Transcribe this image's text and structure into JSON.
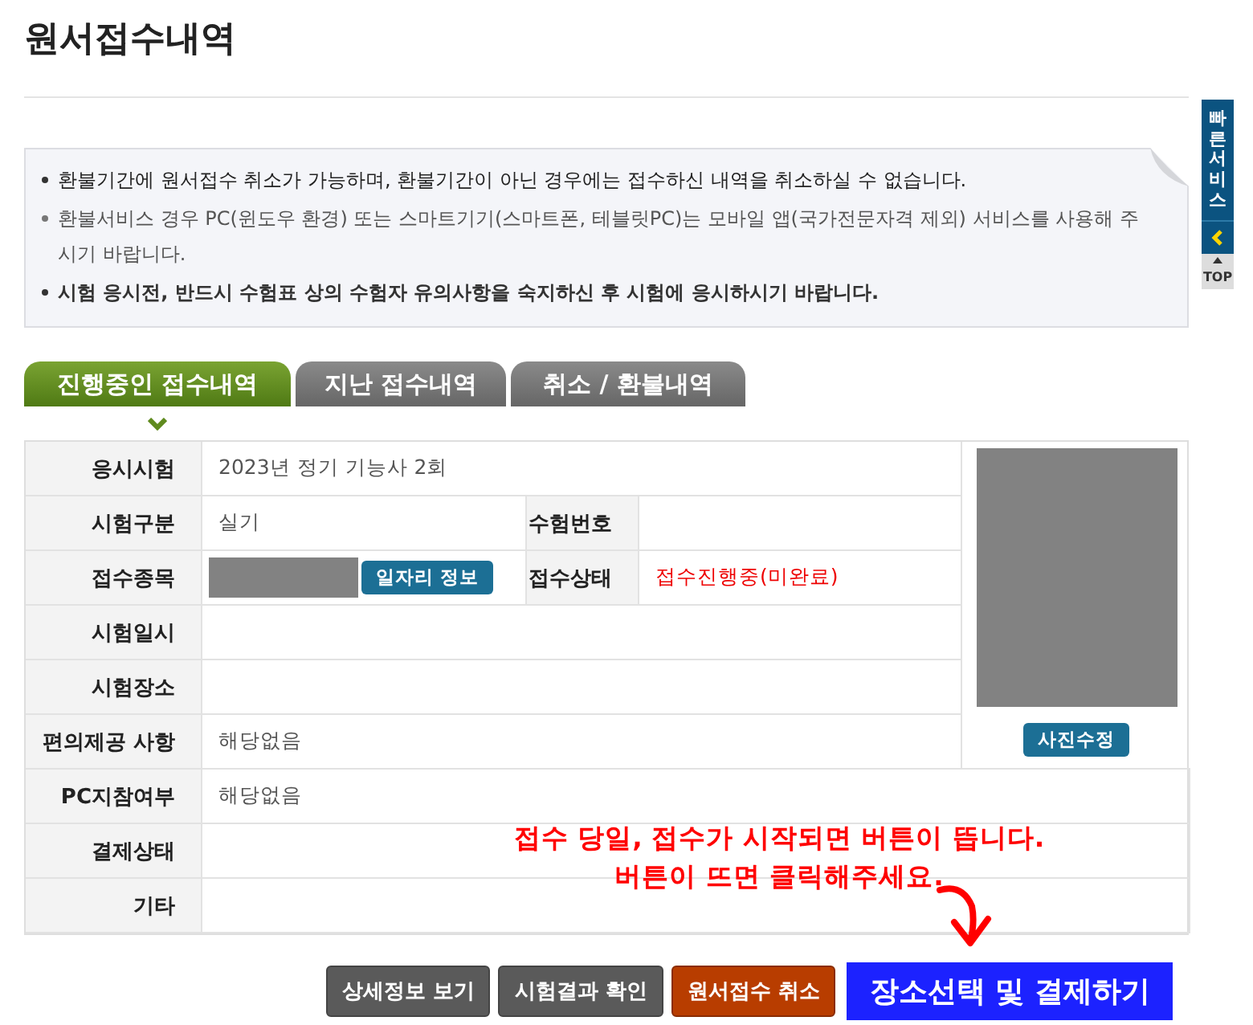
{
  "page_title": "원서접수내역",
  "quick_menu": {
    "label": "빠른서비스",
    "top": "TOP"
  },
  "notices": [
    {
      "text": "환불기간에 원서접수 취소가 가능하며, 환불기간이 아닌 경우에는 접수하신 내역을 취소하실 수 없습니다.",
      "kind": "plain"
    },
    {
      "text": "환불서비스 경우 PC(윈도우 환경) 또는 스마트기기(스마트폰, 테블릿PC)는 모바일 앱(국가전문자격 제외) 서비스를 사용해 주시기 바랍니다.",
      "kind": "muted"
    },
    {
      "text": "시험 응시전, 반드시 수험표 상의 수험자 유의사항을 숙지하신 후 시험에 응시하시기 바랍니다.",
      "kind": "bold"
    }
  ],
  "tabs": [
    {
      "label": "진행중인 접수내역",
      "selected": true
    },
    {
      "label": "지난 접수내역",
      "selected": false
    },
    {
      "label": "취소 / 환불내역",
      "selected": false
    }
  ],
  "details": [
    {
      "label": "응시시험",
      "value": "2023년 정기 기능사 2회"
    },
    {
      "label": "시험구분",
      "value": "실기",
      "pair": {
        "label": "수험번호"
      }
    },
    {
      "label": "접수종목",
      "redacted": true,
      "button": "일자리 정보",
      "pair": {
        "label": "접수상태",
        "value": "접수진행중(미완료)",
        "kind": "alert"
      }
    },
    {
      "label": "시험일시"
    },
    {
      "label": "시험장소"
    },
    {
      "label": "편의제공 사항",
      "value": "해당없음"
    },
    {
      "label": "PC지참여부",
      "value": "해당없음"
    },
    {
      "label": "결제상태"
    },
    {
      "label": "기타"
    }
  ],
  "photo": {
    "redacted": true,
    "button": "사진수정"
  },
  "annotation": {
    "lines": [
      "접수 당일, 접수가 시작되면 버튼이 뜹니다.",
      "버튼이 뜨면 클릭해주세요."
    ]
  },
  "buttons": [
    {
      "label": "상세정보 보기",
      "kind": "dark"
    },
    {
      "label": "시험결과 확인",
      "kind": "dark"
    },
    {
      "label": "원서접수 취소",
      "kind": "danger"
    },
    {
      "label": "장소선택 및 결제하기",
      "kind": "primary"
    }
  ]
}
